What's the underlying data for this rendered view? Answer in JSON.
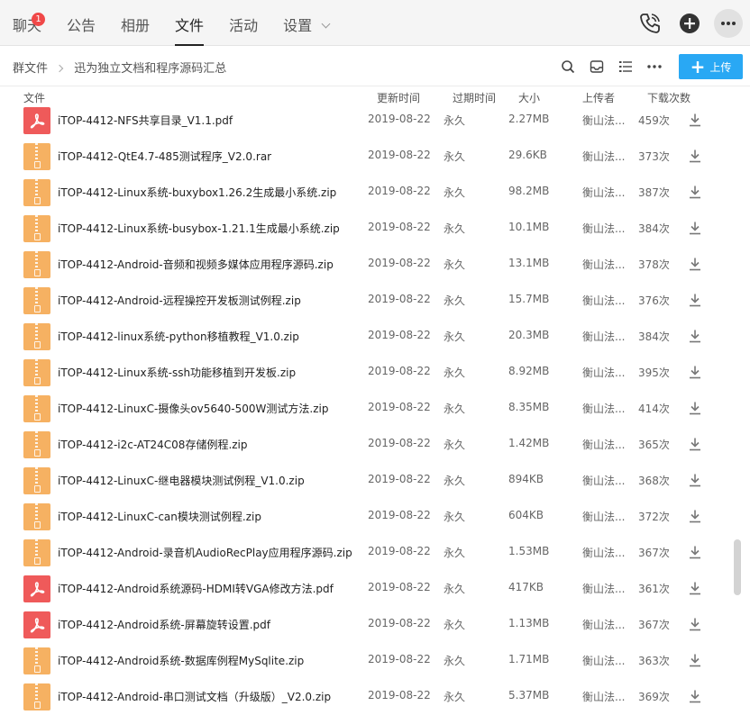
{
  "tabs": [
    {
      "label": "聊天",
      "badge": "1"
    },
    {
      "label": "公告"
    },
    {
      "label": "相册"
    },
    {
      "label": "文件",
      "active": true
    },
    {
      "label": "活动"
    },
    {
      "label": "设置",
      "dropdown": true
    }
  ],
  "top_icons": [
    "phone-icon",
    "add-circle-icon",
    "more-icon"
  ],
  "breadcrumb": {
    "root": "群文件",
    "current": "迅为独立文档和程序源码汇总"
  },
  "toolbar": {
    "icons": [
      "search-icon",
      "inbox-icon",
      "list-view-icon",
      "more-icon"
    ],
    "upload_label": "上传"
  },
  "columns": {
    "name": "文件",
    "updated": "更新时间",
    "expires": "过期时间",
    "size": "大小",
    "uploader": "上传者",
    "downloads": "下载次数"
  },
  "files": [
    {
      "name": "iTOP-4412-NFS共享目录_V1.1.pdf",
      "type": "pdf",
      "date": "2019-08-22",
      "expire": "永久",
      "size": "2.27MB",
      "uploader": "衡山法...",
      "downloads": "459次"
    },
    {
      "name": "iTOP-4412-QtE4.7-485测试程序_V2.0.rar",
      "type": "zip",
      "date": "2019-08-22",
      "expire": "永久",
      "size": "29.6KB",
      "uploader": "衡山法...",
      "downloads": "373次"
    },
    {
      "name": "iTOP-4412-Linux系统-buxybox1.26.2生成最小系统.zip",
      "type": "zip",
      "date": "2019-08-22",
      "expire": "永久",
      "size": "98.2MB",
      "uploader": "衡山法...",
      "downloads": "387次"
    },
    {
      "name": "iTOP-4412-Linux系统-busybox-1.21.1生成最小系统.zip",
      "type": "zip",
      "date": "2019-08-22",
      "expire": "永久",
      "size": "10.1MB",
      "uploader": "衡山法...",
      "downloads": "384次"
    },
    {
      "name": "iTOP-4412-Android-音频和视频多媒体应用程序源码.zip",
      "type": "zip",
      "date": "2019-08-22",
      "expire": "永久",
      "size": "13.1MB",
      "uploader": "衡山法...",
      "downloads": "378次"
    },
    {
      "name": "iTOP-4412-Android-远程操控开发板测试例程.zip",
      "type": "zip",
      "date": "2019-08-22",
      "expire": "永久",
      "size": "15.7MB",
      "uploader": "衡山法...",
      "downloads": "376次"
    },
    {
      "name": "iTOP-4412-linux系统-python移植教程_V1.0.zip",
      "type": "zip",
      "date": "2019-08-22",
      "expire": "永久",
      "size": "20.3MB",
      "uploader": "衡山法...",
      "downloads": "384次"
    },
    {
      "name": "iTOP-4412-Linux系统-ssh功能移植到开发板.zip",
      "type": "zip",
      "date": "2019-08-22",
      "expire": "永久",
      "size": "8.92MB",
      "uploader": "衡山法...",
      "downloads": "395次"
    },
    {
      "name": "iTOP-4412-LinuxC-摄像头ov5640-500W测试方法.zip",
      "type": "zip",
      "date": "2019-08-22",
      "expire": "永久",
      "size": "8.35MB",
      "uploader": "衡山法...",
      "downloads": "414次"
    },
    {
      "name": "iTOP-4412-i2c-AT24C08存储例程.zip",
      "type": "zip",
      "date": "2019-08-22",
      "expire": "永久",
      "size": "1.42MB",
      "uploader": "衡山法...",
      "downloads": "365次"
    },
    {
      "name": "iTOP-4412-LinuxC-继电器模块测试例程_V1.0.zip",
      "type": "zip",
      "date": "2019-08-22",
      "expire": "永久",
      "size": "894KB",
      "uploader": "衡山法...",
      "downloads": "368次"
    },
    {
      "name": "iTOP-4412-LinuxC-can模块测试例程.zip",
      "type": "zip",
      "date": "2019-08-22",
      "expire": "永久",
      "size": "604KB",
      "uploader": "衡山法...",
      "downloads": "372次"
    },
    {
      "name": "iTOP-4412-Android-录音机AudioRecPlay应用程序源码.zip",
      "type": "zip",
      "date": "2019-08-22",
      "expire": "永久",
      "size": "1.53MB",
      "uploader": "衡山法...",
      "downloads": "367次"
    },
    {
      "name": "iTOP-4412-Android系统源码-HDMI转VGA修改方法.pdf",
      "type": "pdf",
      "date": "2019-08-22",
      "expire": "永久",
      "size": "417KB",
      "uploader": "衡山法...",
      "downloads": "361次"
    },
    {
      "name": "iTOP-4412-Android系统-屏幕旋转设置.pdf",
      "type": "pdf",
      "date": "2019-08-22",
      "expire": "永久",
      "size": "1.13MB",
      "uploader": "衡山法...",
      "downloads": "367次"
    },
    {
      "name": "iTOP-4412-Android系统-数据库例程MySqlite.zip",
      "type": "zip",
      "date": "2019-08-22",
      "expire": "永久",
      "size": "1.71MB",
      "uploader": "衡山法...",
      "downloads": "363次"
    },
    {
      "name": "iTOP-4412-Android-串口测试文档（升级版）_V2.0.zip",
      "type": "zip",
      "date": "2019-08-22",
      "expire": "永久",
      "size": "5.37MB",
      "uploader": "衡山法...",
      "downloads": "369次"
    }
  ],
  "colors": {
    "accent": "#29a8f4",
    "zip_icon": "#f6b162",
    "pdf_icon": "#ef5a5a",
    "badge": "#f04848"
  }
}
